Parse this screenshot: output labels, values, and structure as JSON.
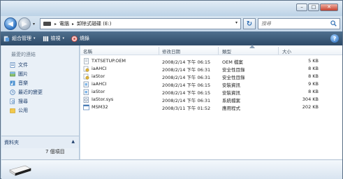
{
  "window": {
    "caption": {
      "minimize": "–",
      "maximize": "□",
      "close": "✕"
    }
  },
  "address": {
    "back": "◀",
    "forward": "▶",
    "separator": "▸",
    "dropdown": "▾",
    "crumbs": [
      "電腦",
      "卸除式磁碟 (E:)"
    ],
    "refresh": "↻",
    "search_placeholder": "搜尋"
  },
  "toolbar": {
    "organize": "組合管理",
    "views": "檢視",
    "burn": "燒錄",
    "help": "?",
    "caret": "▾"
  },
  "nav": {
    "favorites_title": "最愛的連結",
    "items": [
      "文件",
      "圖片",
      "音樂",
      "最近的變更",
      "搜尋",
      "公用"
    ],
    "folders_label": "資料夾",
    "folders_caret": "▲"
  },
  "columns": [
    "名稱",
    "修改日期",
    "類型",
    "大小"
  ],
  "files": [
    {
      "name": "TXTSETUP.OEM",
      "date": "2008/2/14 下午 06:15",
      "type": "OEM 檔案",
      "size": "5 KB",
      "icon": "text-file-icon"
    },
    {
      "name": "iaAHCI",
      "date": "2008/2/14 下午 06:31",
      "type": "安全性目錄",
      "size": "8 KB",
      "icon": "security-catalog-icon"
    },
    {
      "name": "iaStor",
      "date": "2008/2/14 下午 06:31",
      "type": "安全性目錄",
      "size": "8 KB",
      "icon": "security-catalog-icon"
    },
    {
      "name": "iaAHCI",
      "date": "2008/2/14 下午 06:15",
      "type": "安裝資訊",
      "size": "9 KB",
      "icon": "setup-info-icon"
    },
    {
      "name": "iaStor",
      "date": "2008/2/14 下午 06:15",
      "type": "安裝資訊",
      "size": "8 KB",
      "icon": "setup-info-icon"
    },
    {
      "name": "IaStor.sys",
      "date": "2008/2/14 下午 06:31",
      "type": "系統檔案",
      "size": "304 KB",
      "icon": "system-file-icon"
    },
    {
      "name": "MSM32",
      "date": "2008/3/11 下午 01:52",
      "type": "應用程式",
      "size": "202 KB",
      "icon": "application-icon"
    }
  ],
  "details": {
    "status": "7 個項目"
  }
}
